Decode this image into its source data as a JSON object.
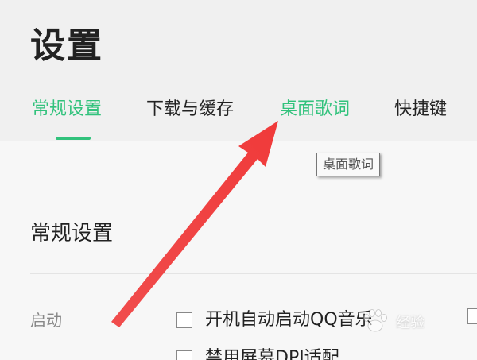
{
  "page": {
    "title": "设置"
  },
  "tabs": [
    {
      "label": "常规设置",
      "active": true
    },
    {
      "label": "下载与缓存",
      "active": false
    },
    {
      "label": "桌面歌词",
      "active": false,
      "hovered": true
    },
    {
      "label": "快捷键",
      "active": false
    }
  ],
  "tooltip": {
    "text": "桌面歌词"
  },
  "section": {
    "title": "常规设置",
    "rows": [
      {
        "label": "启动",
        "options": [
          {
            "label": "开机自动启动QQ音乐",
            "checked": false
          },
          {
            "label": "禁用屏幕DPI适配",
            "checked": false
          }
        ]
      }
    ]
  },
  "watermark": {
    "text": "经验"
  },
  "colors": {
    "accent": "#31c27c",
    "arrow": "#f03a3a",
    "text": "#222222",
    "muted": "#888888"
  }
}
